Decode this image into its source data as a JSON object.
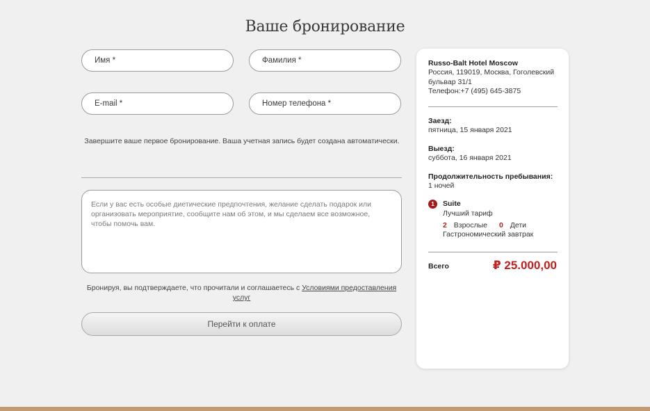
{
  "page": {
    "title": "Ваше бронирование"
  },
  "form": {
    "first_name_placeholder": "Имя *",
    "last_name_placeholder": "Фамилия *",
    "email_placeholder": "E-mail *",
    "phone_placeholder": "Номер телефона *",
    "account_note": "Завершите ваше первое бронирование. Ваша учетная запись будет создана автоматически.",
    "comments_placeholder": "Если у вас есть особые диетические предпочтения, желание сделать подарок или организовать мероприятие, сообщите нам об этом, и мы сделаем все возможное, чтобы помочь вам.",
    "terms_text": "Бронируя, вы подтверждаете, что прочитали и соглашаетесь с ",
    "terms_link": "Условиями предоставления услуг",
    "pay_button": "Перейти к оплате"
  },
  "summary": {
    "hotel_name": "Russo-Balt Hotel Moscow",
    "address": "Россия, 119019, Москва, Гоголевский бульвар 31/1",
    "phone": "Телефон:+7 (495) 645-3875",
    "checkin_label": "Заезд:",
    "checkin_value": "пятница, 15 января 2021",
    "checkout_label": "Выезд:",
    "checkout_value": "суббота, 16 января 2021",
    "duration_label": "Продолжительность пребывания:",
    "duration_value": "1 ночей",
    "room": {
      "number": "1",
      "name": "Suite",
      "rate": "Лучший тариф",
      "adults_count": "2",
      "adults_label": "Взрослые",
      "children_count": "0",
      "children_label": "Дети",
      "meal": "Гастрономический завтрак"
    },
    "total_label": "Всего",
    "total_value": "₽ 25.000,00"
  },
  "colors": {
    "accent_red": "#c41f1f",
    "footer_bar": "#c49a72",
    "background": "#f0f0f0"
  }
}
